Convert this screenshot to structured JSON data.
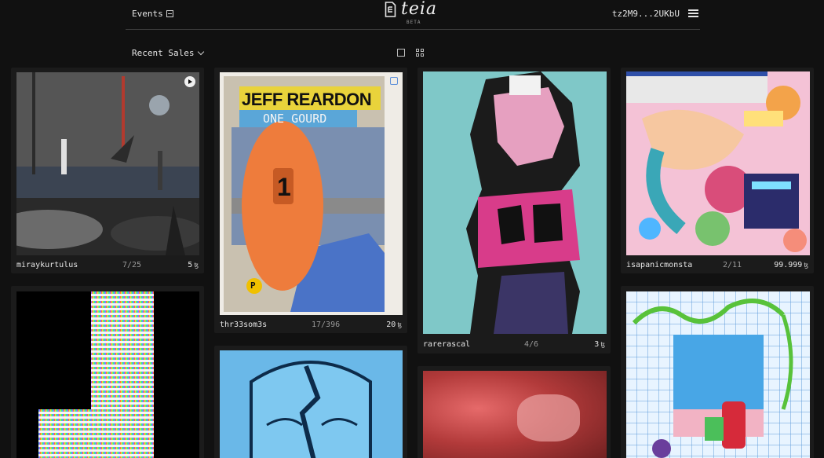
{
  "header": {
    "events_label": "Events",
    "brand_name": "teia",
    "beta_label": "BETA",
    "wallet": "tz2M9...2UKbU"
  },
  "toolbar": {
    "sort_label": "Recent Sales"
  },
  "cards": [
    {
      "artist": "miraykurtulus",
      "edition": "7/25",
      "price": "5",
      "currency": "ꜩ"
    },
    {
      "artist": "thr33som3s",
      "edition": "17/396",
      "price": "20",
      "currency": "ꜩ"
    },
    {
      "artist": "rarerascal",
      "edition": "4/6",
      "price": "3",
      "currency": "ꜩ"
    },
    {
      "artist": "isapanicmonsta",
      "edition": "2/11",
      "price": "99.999",
      "currency": "ꜩ"
    }
  ],
  "artwork_text": {
    "card2_title": "JEFF REARDON",
    "card2_subtitle": "ONE GOURD",
    "card2_number": "1",
    "card2_badge": "P"
  },
  "colors": {
    "background": "#111111",
    "card": "#1b1b1b",
    "divider": "#3a3a3a",
    "muted_text": "#9a9a9a"
  }
}
